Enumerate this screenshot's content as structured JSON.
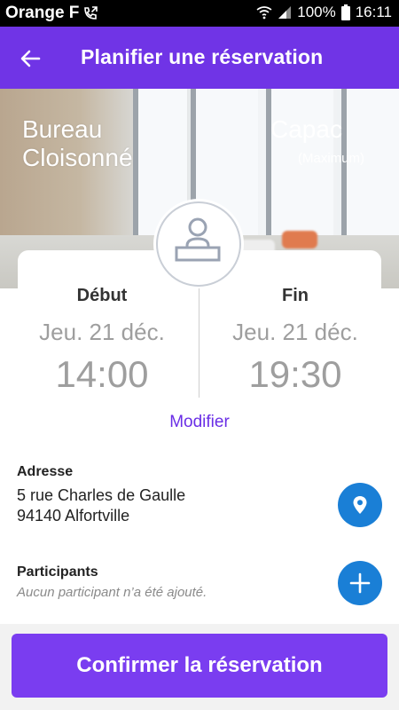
{
  "status_bar": {
    "carrier": "Orange F",
    "battery": "100%",
    "time": "16:11"
  },
  "app_bar": {
    "title": "Planifier une réservation"
  },
  "hero": {
    "room_name_line1": "Bureau",
    "room_name_line2": "Cloisonné",
    "capacity_label": "Capac",
    "capacity_hint": "(Maximum)"
  },
  "schedule": {
    "start": {
      "label": "Début",
      "date": "Jeu. 21 déc.",
      "time": "14:00"
    },
    "end": {
      "label": "Fin",
      "date": "Jeu. 21 déc.",
      "time": "19:30"
    },
    "modify_label": "Modifier"
  },
  "address": {
    "label": "Adresse",
    "line1": "5 rue Charles de Gaulle",
    "line2": "94140 Alfortville"
  },
  "participants": {
    "label": "Participants",
    "empty_text": "Aucun participant n’a été ajouté."
  },
  "confirm": {
    "label": "Confirmer la réservation"
  },
  "colors": {
    "primary": "#7034e6",
    "accent_link": "#6a2ee6",
    "fab": "#1a7fd6",
    "muted_text": "#9e9e9e"
  }
}
